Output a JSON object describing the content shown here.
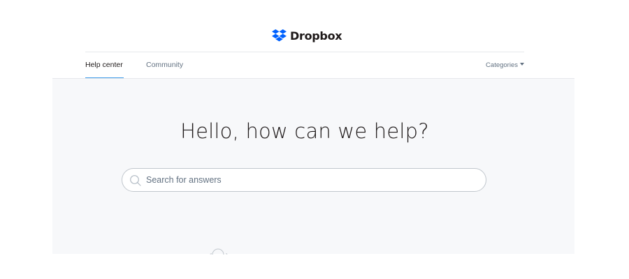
{
  "brand": {
    "name": "Dropbox",
    "logo_icon": "dropbox-logo-icon",
    "logo_color": "#0061fe"
  },
  "nav": {
    "tabs": [
      {
        "label": "Help center",
        "active": true
      },
      {
        "label": "Community",
        "active": false
      }
    ],
    "categories_label": "Categories",
    "accent_color": "#3d9ae8"
  },
  "hero": {
    "title": "Hello, how can we help?",
    "search": {
      "placeholder": "Search for answers",
      "value": "",
      "icon": "search-icon"
    }
  },
  "colors": {
    "hero_background": "#f7f8fa",
    "text_primary": "#1e1919",
    "text_secondary": "#637282"
  }
}
